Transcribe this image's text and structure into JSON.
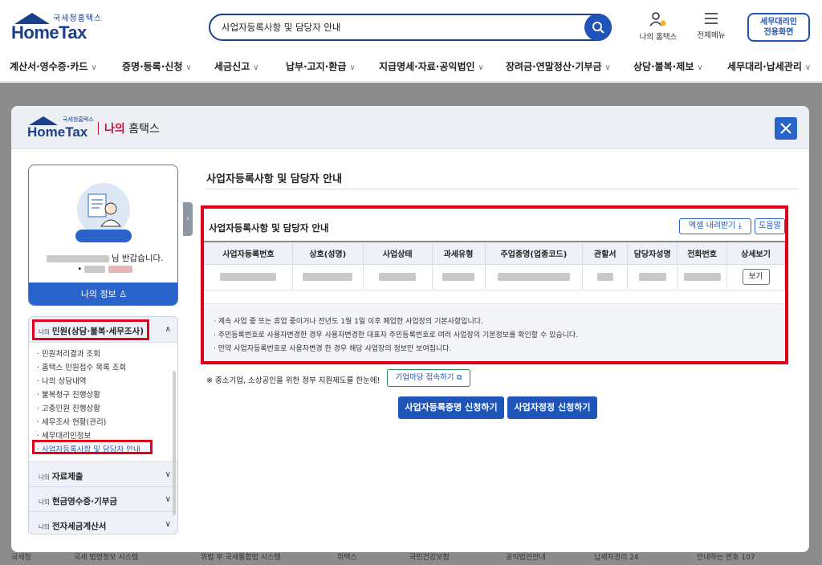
{
  "header": {
    "logo_sub": "국세청홈택스",
    "logo_main": "HomeTax",
    "search_value": "사업자등록사항 및 담당자 안내",
    "my_hometax": "나의 홈택스",
    "all_menu": "전체메뉴",
    "tax_agent_line1": "세무대리인",
    "tax_agent_line2": "전용화면"
  },
  "gnb": [
    "계산서·영수증·카드",
    "증명·등록·신청",
    "세금신고",
    "납부·고지·환급",
    "지급명세·자료·공익법인",
    "장려금·연말정산·기부금",
    "상담·불복·제보",
    "세무대리·납세관리"
  ],
  "modal": {
    "logo_sub": "국세청홈택스",
    "logo_main": "HomeTax",
    "title_red": "나의",
    "title_rest": "홈택스"
  },
  "profile": {
    "greeting": "님 반갑습니다.",
    "my_info": "나의 정보"
  },
  "menu": {
    "section_small": "나의",
    "section_title": "민원(상담·불복·세무조사)",
    "items": [
      "· 민원처리결과 조회",
      "· 홈택스 민원접수 목록 조회",
      "· 나의 상담내역",
      "· 불복청구 진행상황",
      "· 고충민원 진행상황",
      "· 세무조사 현황(관리)",
      "· 세무대리인정보",
      "· 사업자등록사항 및 담당자 안내"
    ],
    "sections": [
      {
        "small": "나의",
        "title": "자료제출"
      },
      {
        "small": "나의",
        "title": "현금영수증·기부금"
      },
      {
        "small": "나의",
        "title": "전자세금계산서"
      }
    ]
  },
  "content": {
    "page_title": "사업자등록사항 및 담당자 안내",
    "panel_title": "사업자등록사항 및 담당자 안내",
    "excel_button": "엑셀 내려받기",
    "help_button": "도움말",
    "columns": [
      "사업자등록번호",
      "상호(성명)",
      "사업상태",
      "과세유형",
      "주업종명(업종코드)",
      "관할서",
      "담당자성명",
      "전화번호",
      "상세보기"
    ],
    "view_button": "보기",
    "notes": [
      "· 계속 사업 중 또는 휴업 중이거나 전년도 1월 1일 이후 폐업한 사업장의 기본사항입니다.",
      "· 주민등록번호로 사용자변경한 경우 사용자변경한 대표자 주민등록번호로 여러 사업장의 기본정보를 확인할 수 있습니다.",
      "· 만약 사업자등록번호로 사용자변경 한 경우 해당 사업장의 정보만 보여집니다."
    ],
    "promo_text": "※ 중소기업, 소상공인을 위한 정부 지원제도를 한눈에!",
    "promo_button": "기업마당 접속하기",
    "apply_cert_button": "사업자등록증명 신청하기",
    "apply_change_button": "사업자정정 신청하기"
  },
  "footer": [
    "국세청",
    "국세 법령정보 시스템",
    "위법 부 국세통합법 시스템",
    "위택스",
    "국민건강보험",
    "공익법인안내",
    "납세자권리 24",
    "안내하는 번호 107"
  ]
}
